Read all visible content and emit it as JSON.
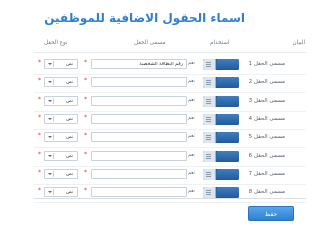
{
  "title": "اسماء الحقول الاضافية للموظفين",
  "headers": {
    "statement": "البيان",
    "use": "استخدام",
    "field_name": "مسمى الحقل",
    "field_type": "نوع الحقل"
  },
  "rows": [
    {
      "label": "مسمى الحقل 1",
      "toggle_text": "نعم",
      "value": "رقم البطاقة الشخصية",
      "type": "نص"
    },
    {
      "label": "مسمى الحقل 2",
      "toggle_text": "نعم",
      "value": "",
      "type": "نص"
    },
    {
      "label": "مسمى الحقل 3",
      "toggle_text": "نعم",
      "value": "",
      "type": "نص"
    },
    {
      "label": "مسمى الحقل 4",
      "toggle_text": "نعم",
      "value": "",
      "type": "نص"
    },
    {
      "label": "مسمى الحقل 5",
      "toggle_text": "نعم",
      "value": "",
      "type": "نص"
    },
    {
      "label": "مسمى الحقل 6",
      "toggle_text": "نعم",
      "value": "",
      "type": "نص"
    },
    {
      "label": "مسمى الحقل 7",
      "toggle_text": "نعم",
      "value": "",
      "type": "نص"
    },
    {
      "label": "مسمى الحقل 8",
      "toggle_text": "نعم",
      "value": "",
      "type": "نص"
    }
  ],
  "required_mark": "*",
  "save_label": "حفظ",
  "colors": {
    "accent": "#2f7fd0",
    "toggle_on": "#2d68a8",
    "required": "#e0342a",
    "button": "#3a8fe0"
  }
}
